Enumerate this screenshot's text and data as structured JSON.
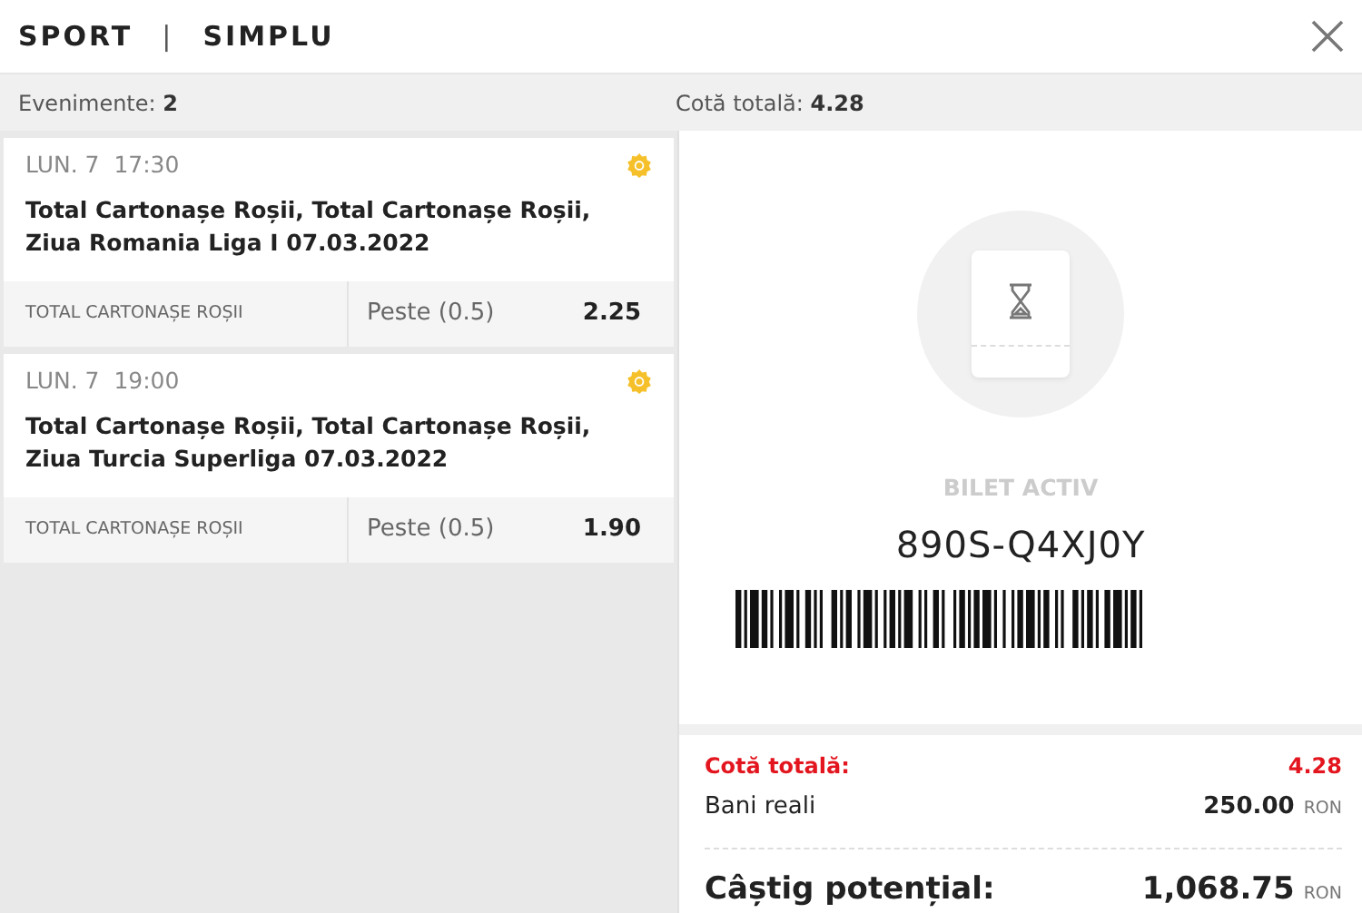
{
  "header": {
    "title": "SPORT",
    "separator": "|",
    "mode": "SIMPLU"
  },
  "summary": {
    "events_label": "Evenimente:",
    "events_value": "2",
    "odds_label": "Cotă totală:",
    "odds_value": "4.28"
  },
  "bets": [
    {
      "date": "LUN. 7",
      "time": "17:30",
      "event": "Total Cartonașe Roșii, Total Cartonașe Roșii, Ziua Romania Liga I 07.03.2022",
      "market": "TOTAL CARTONAȘE ROȘII",
      "selection": "Peste (0.5)",
      "odds": "2.25"
    },
    {
      "date": "LUN. 7",
      "time": "19:00",
      "event": "Total Cartonașe Roșii, Total Cartonașe Roșii, Ziua Turcia Superliga 07.03.2022",
      "market": "TOTAL CARTONAȘE ROȘII",
      "selection": "Peste (0.5)",
      "odds": "1.90"
    }
  ],
  "ticket": {
    "status": "BILET ACTIV",
    "code": "890S-Q4XJ0Y"
  },
  "totals": {
    "odds_label": "Cotă totală:",
    "odds_value": "4.28",
    "stake_label": "Bani reali",
    "stake_value": "250.00",
    "stake_currency": "RON",
    "win_label": "Câștig potențial:",
    "win_value": "1,068.75",
    "win_currency": "RON"
  }
}
